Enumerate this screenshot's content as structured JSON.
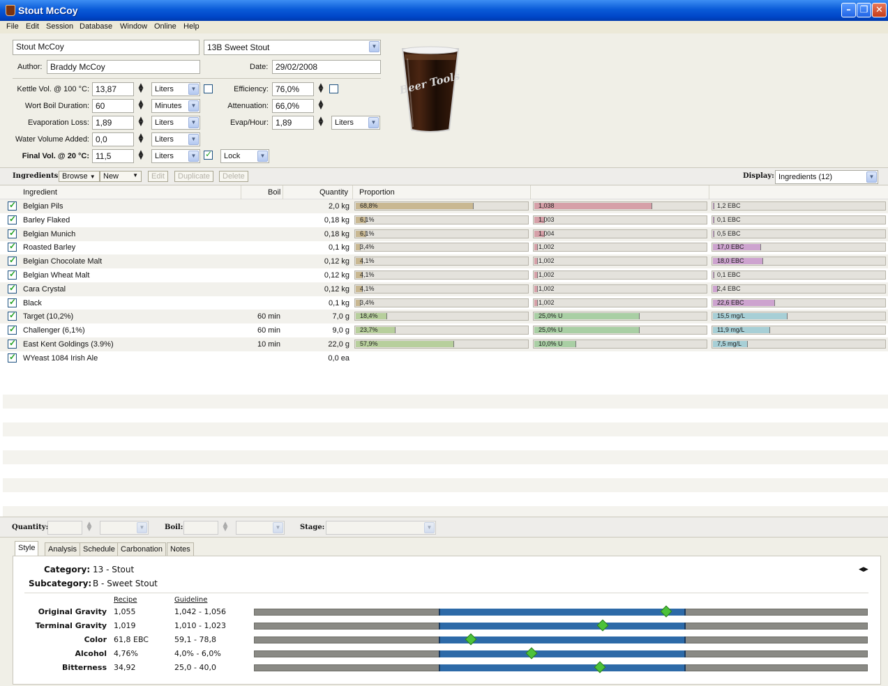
{
  "window": {
    "title": "Stout McCoy"
  },
  "menu": [
    "File",
    "Edit",
    "Session",
    "Database",
    "Window",
    "Online",
    "Help"
  ],
  "recipe": {
    "name": "Stout McCoy",
    "style": "13B Sweet Stout",
    "author_label": "Author:",
    "author": "Braddy McCoy",
    "date_label": "Date:",
    "date": "29/02/2008"
  },
  "params": {
    "kettle_label": "Kettle Vol. @ 100 °C:",
    "kettle_value": "13,87",
    "kettle_unit": "Liters",
    "boil_label": "Wort Boil Duration:",
    "boil_value": "60",
    "boil_unit": "Minutes",
    "evap_label": "Evaporation Loss:",
    "evap_value": "1,89",
    "evap_unit": "Liters",
    "water_label": "Water Volume Added:",
    "water_value": "0,0",
    "water_unit": "Liters",
    "final_label": "Final Vol. @ 20 °C:",
    "final_value": "11,5",
    "final_unit": "Liters",
    "lock_label": "Lock",
    "efficiency_label": "Efficiency:",
    "efficiency_value": "76,0%",
    "attenuation_label": "Attenuation:",
    "attenuation_value": "66,0%",
    "evaphour_label": "Evap/Hour:",
    "evaphour_value": "1,89",
    "evaphour_unit": "Liters"
  },
  "glass_logo": "Beer Tools",
  "toolbar": {
    "ingredients_label": "Ingredients:",
    "browse": "Browse",
    "new": "New",
    "edit": "Edit",
    "duplicate": "Duplicate",
    "delete": "Delete",
    "display_label": "Display:",
    "display_value": "Ingredients (12)"
  },
  "table": {
    "headers": {
      "ingredient": "Ingredient",
      "boil": "Boil",
      "quantity": "Quantity",
      "proportion": "Proportion"
    },
    "rows": [
      {
        "name": "Belgian Pils",
        "boil": "",
        "qty": "2,0 kg",
        "p": "68,8%",
        "pf": 0.68,
        "g": "1,038",
        "gf": 0.68,
        "c": "1,2 EBC",
        "cf": 0.01,
        "kind": "malt"
      },
      {
        "name": "Barley Flaked",
        "boil": "",
        "qty": "0,18 kg",
        "p": "6,1%",
        "pf": 0.06,
        "g": "1,003",
        "gf": 0.06,
        "c": "0,1 EBC",
        "cf": 0.0,
        "kind": "malt"
      },
      {
        "name": "Belgian Munich",
        "boil": "",
        "qty": "0,18 kg",
        "p": "6,1%",
        "pf": 0.06,
        "g": "1,004",
        "gf": 0.06,
        "c": "0,5 EBC",
        "cf": 0.0,
        "kind": "malt"
      },
      {
        "name": "Roasted Barley",
        "boil": "",
        "qty": "0,1 kg",
        "p": "3,4%",
        "pf": 0.03,
        "g": "1,002",
        "gf": 0.02,
        "c": "17,0 EBC",
        "cf": 0.28,
        "kind": "malt"
      },
      {
        "name": "Belgian Chocolate Malt",
        "boil": "",
        "qty": "0,12 kg",
        "p": "4,1%",
        "pf": 0.04,
        "g": "1,002",
        "gf": 0.02,
        "c": "18,0 EBC",
        "cf": 0.29,
        "kind": "malt"
      },
      {
        "name": "Belgian Wheat Malt",
        "boil": "",
        "qty": "0,12 kg",
        "p": "4,1%",
        "pf": 0.04,
        "g": "1,002",
        "gf": 0.02,
        "c": "0,1 EBC",
        "cf": 0.0,
        "kind": "malt"
      },
      {
        "name": "Cara Crystal",
        "boil": "",
        "qty": "0,12 kg",
        "p": "4,1%",
        "pf": 0.04,
        "g": "1,002",
        "gf": 0.02,
        "c": "2,4 EBC",
        "cf": 0.03,
        "kind": "malt"
      },
      {
        "name": "Black",
        "boil": "",
        "qty": "0,1 kg",
        "p": "3,4%",
        "pf": 0.03,
        "g": "1,002",
        "gf": 0.02,
        "c": "22,6 EBC",
        "cf": 0.36,
        "kind": "malt"
      },
      {
        "name": "Target (10,2%)",
        "boil": "60 min",
        "qty": "7,0 g",
        "p": "18,4%",
        "pf": 0.18,
        "g": "25,0% U",
        "gf": 0.61,
        "c": "15,5 mg/L",
        "cf": 0.43,
        "kind": "hop"
      },
      {
        "name": "Challenger (6,1%)",
        "boil": "60 min",
        "qty": "9,0 g",
        "p": "23,7%",
        "pf": 0.23,
        "g": "25,0% U",
        "gf": 0.61,
        "c": "11,9 mg/L",
        "cf": 0.33,
        "kind": "hop"
      },
      {
        "name": "East Kent Goldings (3.9%)",
        "boil": "10 min",
        "qty": "22,0 g",
        "p": "57,9%",
        "pf": 0.57,
        "g": "10,0% U",
        "gf": 0.24,
        "c": "7,5 mg/L",
        "cf": 0.2,
        "kind": "hop"
      },
      {
        "name": "WYeast 1084 Irish Ale",
        "boil": "",
        "qty": "0,0 ea",
        "p": "",
        "pf": 0,
        "g": "",
        "gf": 0,
        "c": "",
        "cf": 0,
        "kind": "yeast"
      }
    ]
  },
  "qtybar": {
    "quantity_label": "Quantity:",
    "boil_label": "Boil:",
    "stage_label": "Stage:"
  },
  "tabs": [
    "Style",
    "Analysis",
    "Schedule",
    "Carbonation",
    "Notes"
  ],
  "style": {
    "category_label": "Category:",
    "category": "13 - Stout",
    "subcategory_label": "Subcategory:",
    "subcategory": "B - Sweet Stout",
    "recipe_head": "Recipe",
    "guideline_head": "Guideline",
    "metrics": [
      {
        "label": "Original Gravity",
        "recipe": "1,055",
        "guide": "1,042 - 1,056",
        "marker": 0.93
      },
      {
        "label": "Terminal Gravity",
        "recipe": "1,019",
        "guide": "1,010 - 1,023",
        "marker": 0.67
      },
      {
        "label": "Color",
        "recipe": "61,8 EBC",
        "guide": "59,1 - 78,8",
        "marker": 0.13
      },
      {
        "label": "Alcohol",
        "recipe": "4,76%",
        "guide": "4,0% - 6,0%",
        "marker": 0.38
      },
      {
        "label": "Bitterness",
        "recipe": "34,92",
        "guide": "25,0 - 40,0",
        "marker": 0.66
      }
    ]
  }
}
